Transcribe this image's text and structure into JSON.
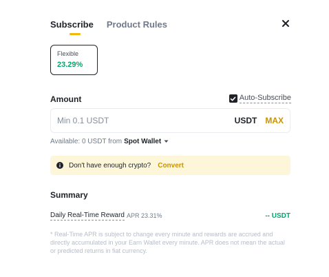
{
  "tabs": [
    {
      "label": "Subscribe",
      "active": true
    },
    {
      "label": "Product Rules",
      "active": false
    }
  ],
  "close_icon": "close-icon",
  "product": {
    "type": "Flexible",
    "apr": "23.29%"
  },
  "amount": {
    "title": "Amount",
    "auto_subscribe_label": "Auto-Subscribe",
    "auto_subscribe_checked": true,
    "placeholder": "Min 0.1 USDT",
    "value": "",
    "unit": "USDT",
    "max_label": "MAX"
  },
  "available": {
    "prefix": "Available: 0 USDT from",
    "wallet": "Spot Wallet"
  },
  "notice": {
    "text": "Don't have enough crypto?",
    "link": "Convert"
  },
  "summary": {
    "title": "Summary",
    "reward_label": "Daily Real-Time Reward",
    "reward_apr": "APR 23.31%",
    "reward_value": "-- USDT"
  },
  "disclaimer": "* Real-Time APR is subject to change every minute and rewards are accrued and directly accumulated in your Earn Wallet every minute. APR does not mean the actual or predicted returns in fiat currency.",
  "colors": {
    "accent": "#f0b90b",
    "positive": "#03a66d",
    "link": "#c99400",
    "notice_bg": "#fef6d8"
  }
}
